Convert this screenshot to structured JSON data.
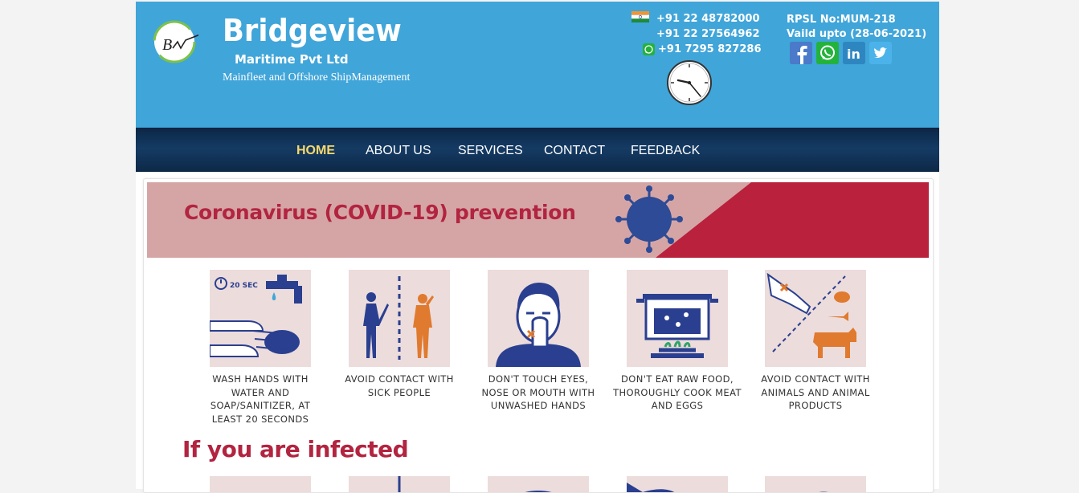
{
  "header": {
    "brand": "Bridgeview",
    "brand_sub": "Maritime Pvt Ltd",
    "tagline": "Mainfleet and Offshore ShipManagement",
    "phones": [
      "+91 22 48782000",
      "+91 22 27564962",
      "+91 7295 827286"
    ],
    "rpsl": "RPSL No:MUM-218",
    "valid": "Vaild upto (28-06-2021)",
    "social_icons": [
      "facebook-icon",
      "whatsapp-icon",
      "linkedin-icon",
      "twitter-icon"
    ],
    "colors": {
      "header_bg": "#40a5d9",
      "nav_bg": "#153b64",
      "nav_active": "#f7d96b",
      "accent_red": "#b22440"
    }
  },
  "nav": {
    "items": [
      {
        "label": "HOME",
        "active": true
      },
      {
        "label": "ABOUT US",
        "active": false
      },
      {
        "label": "SERVICES",
        "active": false
      },
      {
        "label": "CONTACT",
        "active": false
      },
      {
        "label": "FEEDBACK",
        "active": false
      }
    ]
  },
  "covid": {
    "title": "Coronavirus (COVID-19) prevention",
    "timer_label": "20 SEC",
    "tips": [
      {
        "caption": "WASH HANDS WITH WATER AND SOAP/SANITIZER, AT LEAST 20 SECONDS",
        "icon": "hand-washing-icon"
      },
      {
        "caption": "AVOID CONTACT WITH SICK PEOPLE",
        "icon": "avoid-contact-icon"
      },
      {
        "caption": "DON'T TOUCH EYES, NOSE OR MOUTH WITH UNWASHED HANDS",
        "icon": "face-touch-icon"
      },
      {
        "caption": "DON'T EAT RAW FOOD, THOROUGHLY COOK MEAT AND EGGS",
        "icon": "cooking-pot-icon"
      },
      {
        "caption": "AVOID CONTACT WITH ANIMALS AND ANIMAL PRODUCTS",
        "icon": "animals-icon"
      }
    ],
    "infected_title": "If you are infected"
  }
}
